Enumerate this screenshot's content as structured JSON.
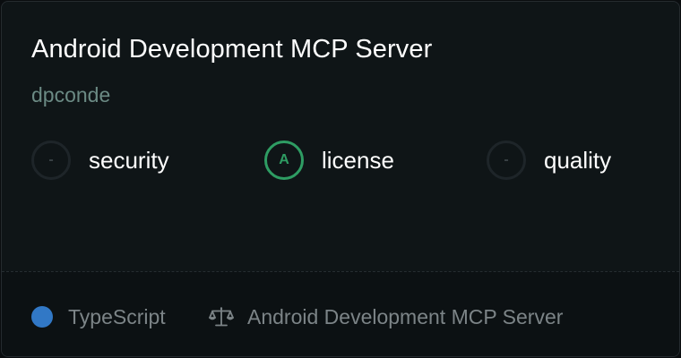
{
  "server": {
    "title": "Android Development MCP Server",
    "author": "dpconde"
  },
  "scores": [
    {
      "grade": "-",
      "label": "security",
      "status": "none"
    },
    {
      "grade": "A",
      "label": "license",
      "status": "good"
    },
    {
      "grade": "-",
      "label": "quality",
      "status": "none"
    }
  ],
  "footer": {
    "language": "TypeScript",
    "language_color": "#3178c6",
    "license_icon": "scale-icon",
    "license_text": "Android Development MCP Server"
  },
  "colors": {
    "accent_good": "#2e9d63",
    "background": "#0f1517"
  }
}
